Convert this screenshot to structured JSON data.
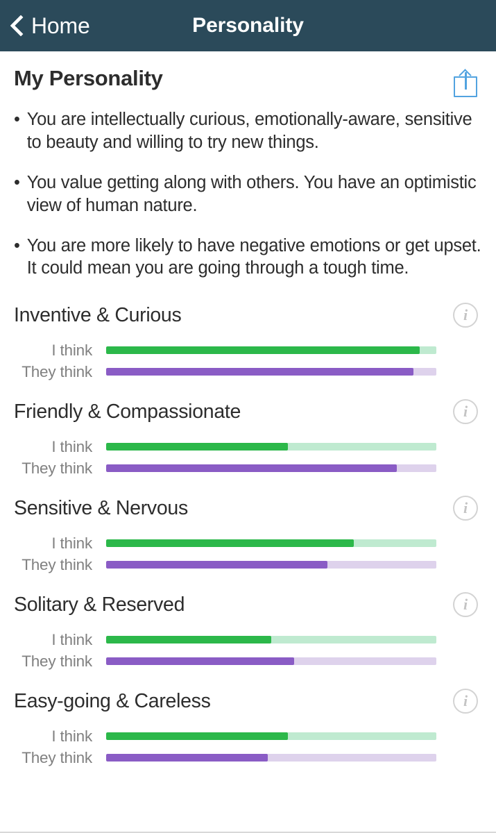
{
  "navbar": {
    "back_label": "Home",
    "title": "Personality",
    "back_icon": "chevron-left-icon",
    "background_color": "#2b4a5a"
  },
  "page": {
    "title": "My Personality",
    "share_icon": "share-icon",
    "share_icon_color": "#52a3e0"
  },
  "bullets": [
    {
      "marker": "•",
      "text": "You are intellectually curious, emotionally-aware, sensitive to beauty and willing to try new things."
    },
    {
      "marker": "•",
      "text": "You value getting along with others. You have an optimistic view of human nature."
    },
    {
      "marker": "•",
      "text": "You are more likely to have negative emotions or get upset. It could mean you are going through a tough time."
    }
  ],
  "labels": {
    "self": "I think",
    "others": "They think",
    "info_icon": "info-icon",
    "info_glyph": "i"
  },
  "colors": {
    "self_fill": "#2cb84a",
    "self_track": "#bfead0",
    "others_fill": "#8a5cc5",
    "others_track": "#ded2ec",
    "header_bg": "#2b4a5a",
    "accent_blue": "#52a3e0",
    "label_gray": "#808080"
  },
  "chart_data": {
    "type": "bar",
    "title": "My Personality",
    "orientation": "horizontal",
    "xlabel": "",
    "ylabel": "",
    "xlim": [
      0,
      100
    ],
    "grid": false,
    "legend": [
      "I think",
      "They think"
    ],
    "legend_position": "row-label",
    "categories": [
      "Inventive & Curious",
      "Friendly & Compassionate",
      "Sensitive & Nervous",
      "Solitary & Reserved",
      "Easy-going & Careless"
    ],
    "series": [
      {
        "name": "I think",
        "color": "#2cb84a",
        "track_color": "#bfead0",
        "values": [
          95,
          55,
          75,
          50,
          55
        ]
      },
      {
        "name": "They think",
        "color": "#8a5cc5",
        "track_color": "#ded2ec",
        "values": [
          93,
          88,
          67,
          57,
          49
        ]
      }
    ]
  },
  "traits": [
    {
      "name": "Inventive & Curious",
      "self": 95,
      "others": 93
    },
    {
      "name": "Friendly & Compassionate",
      "self": 55,
      "others": 88
    },
    {
      "name": "Sensitive & Nervous",
      "self": 75,
      "others": 67
    },
    {
      "name": "Solitary & Reserved",
      "self": 50,
      "others": 57
    },
    {
      "name": "Easy-going & Careless",
      "self": 55,
      "others": 49
    }
  ]
}
